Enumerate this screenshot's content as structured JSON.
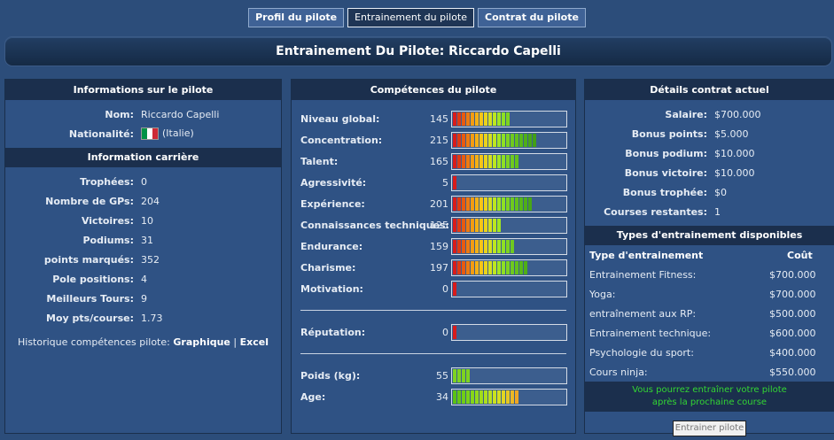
{
  "tabs": [
    {
      "label": "Profil du pilote",
      "active": false
    },
    {
      "label": "Entrainement du pilote",
      "active": true
    },
    {
      "label": "Contrat du pilote",
      "active": false
    }
  ],
  "page_title": "Entrainement Du Pilote: Riccardo Capelli",
  "left": {
    "header": "Informations sur le pilote",
    "name_label": "Nom:",
    "name_value": "Riccardo Capelli",
    "nationality_label": "Nationalité:",
    "nationality_value": "(Italie)",
    "flag_colors": [
      "#009246",
      "#ffffff",
      "#ce2b37"
    ],
    "career_header": "Information carrière",
    "career": [
      {
        "label": "Trophées:",
        "value": "0"
      },
      {
        "label": "Nombre de GPs:",
        "value": "204"
      },
      {
        "label": "Victoires:",
        "value": "10"
      },
      {
        "label": "Podiums:",
        "value": "31"
      },
      {
        "label": "points marqués:",
        "value": "352"
      },
      {
        "label": "Pole positions:",
        "value": "4"
      },
      {
        "label": "Meilleurs Tours:",
        "value": "9"
      },
      {
        "label": "Moy pts/course:",
        "value": "1.73"
      }
    ],
    "history_label": "Historique compétences pilote:",
    "history_link1": "Graphique",
    "history_sep": "|",
    "history_link2": "Excel"
  },
  "mid": {
    "header": "Compétences du pilote",
    "skills": [
      {
        "label": "Niveau global:",
        "value": "145",
        "level": 0.58
      },
      {
        "label": "Concentration:",
        "value": "215",
        "level": 0.86
      },
      {
        "label": "Talent:",
        "value": "165",
        "level": 0.66
      },
      {
        "label": "Agressivité:",
        "value": "5",
        "level": 0.03
      },
      {
        "label": "Expérience:",
        "value": "201",
        "level": 0.8
      },
      {
        "label": "Connaissances techniques:",
        "value": "125",
        "level": 0.5
      },
      {
        "label": "Endurance:",
        "value": "159",
        "level": 0.63
      },
      {
        "label": "Charisme:",
        "value": "197",
        "level": 0.78
      },
      {
        "label": "Motivation:",
        "value": "0",
        "level": 0.03
      }
    ],
    "reputation": {
      "label": "Réputation:",
      "value": "0",
      "level": 0.03
    },
    "physical": [
      {
        "label": "Poids (kg):",
        "value": "55",
        "level": 0.16,
        "scheme": "green"
      },
      {
        "label": "Age:",
        "value": "34",
        "level": 0.7,
        "scheme": "green-to-red"
      }
    ]
  },
  "right": {
    "header": "Détails contrat actuel",
    "contract": [
      {
        "label": "Salaire:",
        "value": "$700.000"
      },
      {
        "label": "Bonus points:",
        "value": "$5.000"
      },
      {
        "label": "Bonus podium:",
        "value": "$10.000"
      },
      {
        "label": "Bonus victoire:",
        "value": "$10.000"
      },
      {
        "label": "Bonus trophée:",
        "value": "$0"
      },
      {
        "label": "Courses restantes:",
        "value": "1"
      }
    ],
    "training_header": "Types d'entrainement disponibles",
    "col_type": "Type d'entrainement",
    "col_cost": "Coût",
    "trainings": [
      {
        "type": "Entrainement Fitness:",
        "cost": "$700.000"
      },
      {
        "type": "Yoga:",
        "cost": "$700.000"
      },
      {
        "type": "entraînement aux RP:",
        "cost": "$500.000"
      },
      {
        "type": "Entrainement technique:",
        "cost": "$600.000"
      },
      {
        "type": "Psychologie du sport:",
        "cost": "$400.000"
      },
      {
        "type": "Cours ninja:",
        "cost": "$550.000"
      }
    ],
    "notice_line1": "Vous pourrez entraîner votre pilote",
    "notice_line2": "après la prochaine course",
    "train_button": "Entrainer pilote"
  }
}
